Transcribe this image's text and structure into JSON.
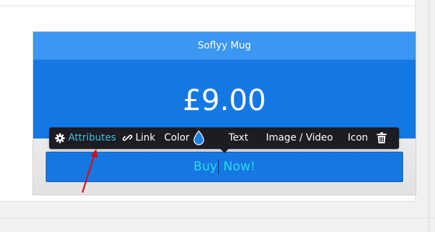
{
  "card": {
    "title": "Soflyy Mug",
    "price": "£9.00"
  },
  "button": {
    "label_before_caret": "Buy",
    "label_after_caret": " Now!"
  },
  "toolbar": {
    "attributes_label": "Attributes",
    "link_label": "Link",
    "color_label": "Color",
    "text_label": "Text",
    "image_video_label": "Image / Video",
    "icon_label": "Icon",
    "icons": [
      "gear-icon",
      "link-icon",
      "color-drop-icon",
      "trash-icon"
    ],
    "accent_color": "#3ec1e6"
  },
  "colors": {
    "header_blue": "#3a97f2",
    "price_blue": "#1478e4",
    "button_text": "#29d8e8",
    "annotation_arrow": "#d0101a"
  }
}
